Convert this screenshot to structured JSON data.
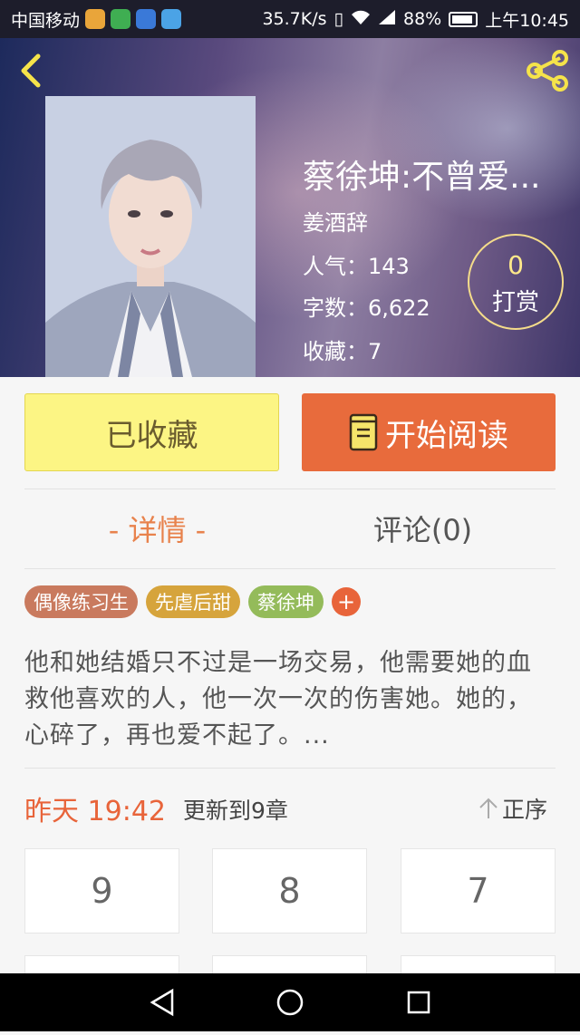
{
  "status_bar": {
    "carrier": "中国移动",
    "net_speed": "35.7K/s",
    "battery": "88%",
    "time": "上午10:45"
  },
  "book": {
    "title": "蔡徐坤:不曾爱...",
    "author": "姜酒辞",
    "popularity": "人气：143",
    "word_count": "字数：6,622",
    "favorites": "收藏：7",
    "tip_count": "0",
    "tip_label": "打赏"
  },
  "actions": {
    "favorite_label": "已收藏",
    "read_label": "开始阅读"
  },
  "tabs": {
    "detail": "- 详情 -",
    "comments": "评论(0)"
  },
  "tags": [
    {
      "label": "偶像练习生",
      "color": "#c97a5e"
    },
    {
      "label": "先虐后甜",
      "color": "#d6a43c"
    },
    {
      "label": "蔡徐坤",
      "color": "#94bb5a"
    }
  ],
  "tag_add": "+",
  "description": "他和她结婚只不过是一场交易，他需要她的血救他喜欢的人，他一次一次的伤害她。她的，心碎了，再也爱不起了。...",
  "update": {
    "time": "昨天 19:42",
    "text": "更新到9章",
    "sort_label": "正序"
  },
  "chapters": [
    "9",
    "8",
    "7"
  ],
  "colors": {
    "accent": "#e8643a",
    "fav_bg": "#fcf584",
    "read_bg": "#e86b3c"
  }
}
